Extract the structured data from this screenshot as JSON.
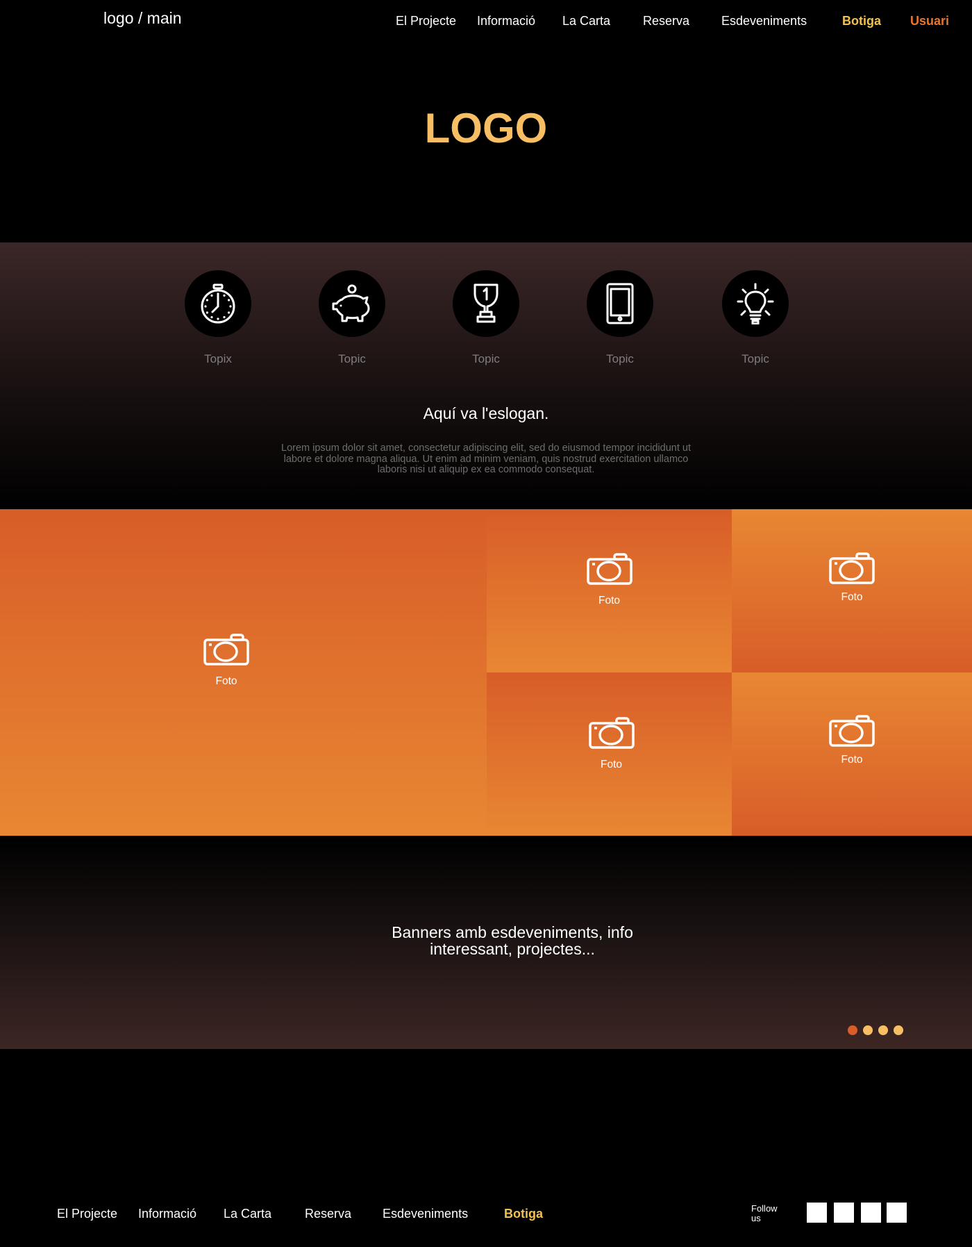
{
  "header": {
    "logo_text": "logo / main",
    "nav": [
      {
        "label": "El Projecte"
      },
      {
        "label": "Informació"
      },
      {
        "label": "La Carta"
      },
      {
        "label": "Reserva"
      },
      {
        "label": "Esdeveniments"
      },
      {
        "label": "Botiga"
      },
      {
        "label": "Usuari"
      }
    ]
  },
  "hero": {
    "logo": "LOGO",
    "logo_color": "#F8BE64"
  },
  "topics": {
    "items": [
      {
        "label": "Topix",
        "icon": "stopwatch-icon"
      },
      {
        "label": "Topic",
        "icon": "piggy-bank-icon"
      },
      {
        "label": "Topic",
        "icon": "trophy-icon"
      },
      {
        "label": "Topic",
        "icon": "tablet-icon"
      },
      {
        "label": "Topic",
        "icon": "lightbulb-icon"
      }
    ],
    "slogan": "Aquí va l'eslogan.",
    "description": "Lorem ipsum dolor sit amet, consectetur adipiscing elit, sed do eiusmod tempor incididunt ut labore et dolore magna aliqua. Ut enim ad minim veniam, quis nostrud exercitation ullamco laboris nisi ut aliquip ex ea commodo consequat."
  },
  "gallery": {
    "tiles": [
      {
        "label": "Foto",
        "icon": "camera-icon"
      },
      {
        "label": "Foto",
        "icon": "camera-icon"
      },
      {
        "label": "Foto",
        "icon": "camera-icon"
      },
      {
        "label": "Foto",
        "icon": "camera-icon"
      },
      {
        "label": "Foto",
        "icon": "camera-icon"
      }
    ],
    "colors": {
      "dark_orange": "#D85D28",
      "light_orange": "#E88733"
    }
  },
  "banner": {
    "line1": "Banners amb esdeveniments, info",
    "line2": "interessant, projectes...",
    "dots": [
      {
        "color": "#D85D28",
        "active": true
      },
      {
        "color": "#F8BE64",
        "active": false
      },
      {
        "color": "#F8BE64",
        "active": false
      },
      {
        "color": "#F8BE64",
        "active": false
      }
    ]
  },
  "footer": {
    "nav": [
      {
        "label": "El Projecte"
      },
      {
        "label": "Informació"
      },
      {
        "label": "La Carta"
      },
      {
        "label": "Reserva"
      },
      {
        "label": "Esdeveniments"
      },
      {
        "label": "Botiga"
      }
    ],
    "follow_label": "Follow us",
    "social_count": 4
  },
  "colors": {
    "accent_yellow": "#F2C24F",
    "accent_orange": "#E8762E",
    "background": "#000000"
  }
}
